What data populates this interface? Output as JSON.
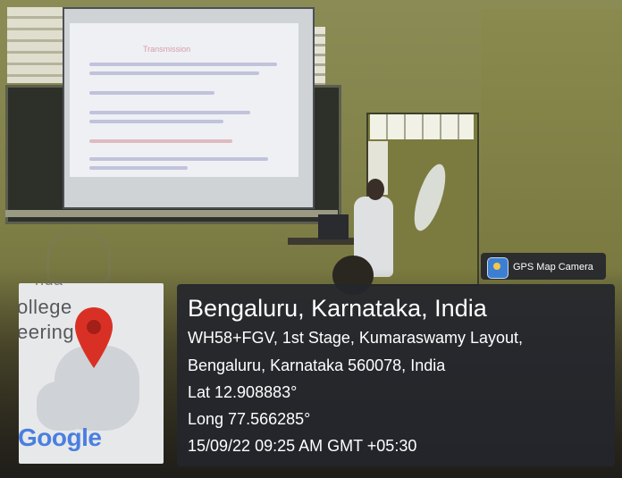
{
  "photo": {
    "description_visible_text": {
      "slide_title": "Transmission"
    }
  },
  "overlay": {
    "badge": {
      "icon": "gps-map-camera-icon",
      "label": "GPS Map Camera"
    },
    "map": {
      "fragment_1": "nda",
      "fragment_2": "ollege",
      "fragment_3": "eering",
      "logo_text": "Google",
      "pin_color": "#d93025"
    },
    "location": {
      "city_line": "Bengaluru, Karnataka, India",
      "address_line_1": "WH58+FGV, 1st Stage, Kumaraswamy Layout,",
      "address_line_2": "Bengaluru, Karnataka 560078, India",
      "latitude": "Lat 12.908883°",
      "longitude": "Long 77.566285°",
      "timestamp": "15/09/22 09:25 AM GMT +05:30"
    }
  }
}
